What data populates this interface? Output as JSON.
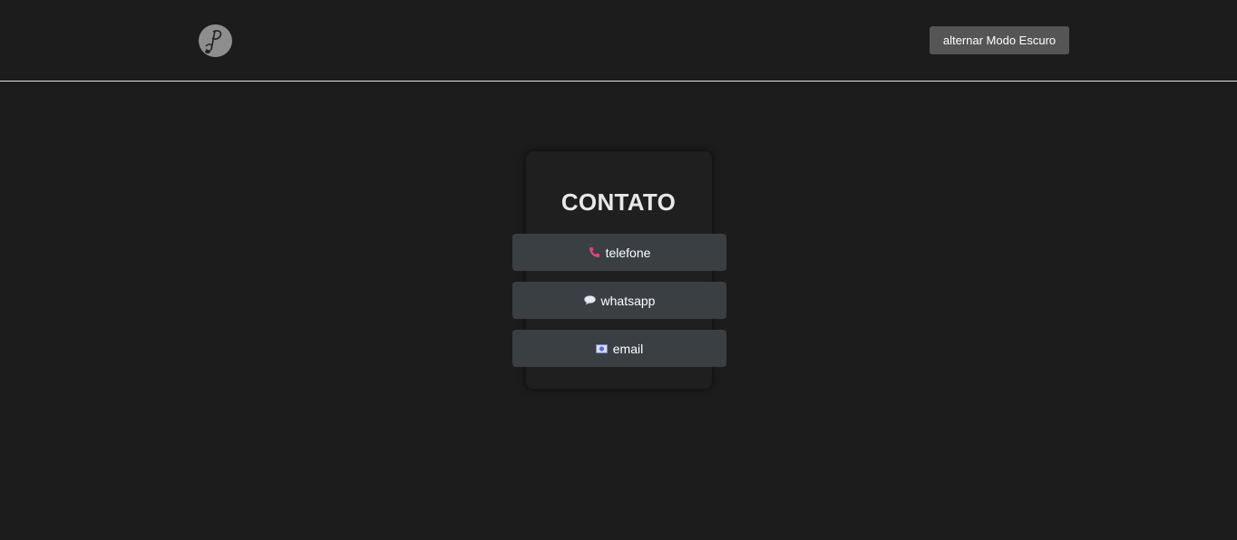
{
  "header": {
    "logo_icon": "music-note-logo-icon",
    "toggle_label": "alternar Modo Escuro"
  },
  "contact": {
    "title": "CONTATO",
    "buttons": [
      {
        "label": "telefone",
        "icon": "phone-icon",
        "icon_color": "#e0447a"
      },
      {
        "label": "whatsapp",
        "icon": "speech-bubble-icon",
        "icon_color": "#e8e8f5"
      },
      {
        "label": "email",
        "icon": "email-icon",
        "icon_color": "#5a6fd8"
      }
    ]
  },
  "colors": {
    "background": "#1c1c1c",
    "button": "#3a3f44",
    "toggle": "#555555",
    "divider": "#e8e8e8"
  }
}
